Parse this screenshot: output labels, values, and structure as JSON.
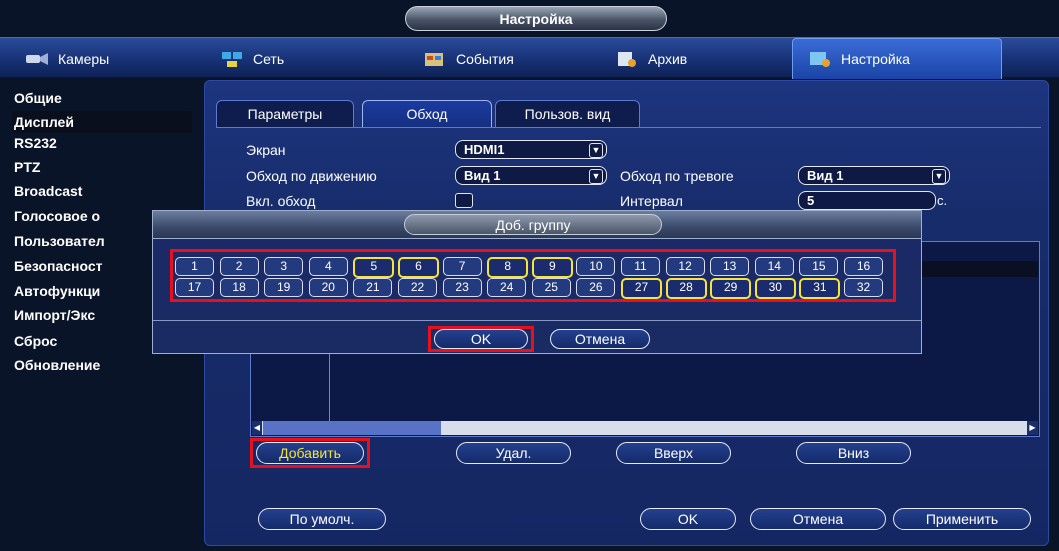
{
  "window": {
    "title": "Настройка"
  },
  "topnav": {
    "items": [
      {
        "label": "Камеры",
        "icon": "camera-icon"
      },
      {
        "label": "Сеть",
        "icon": "network-icon"
      },
      {
        "label": "События",
        "icon": "events-icon"
      },
      {
        "label": "Архив",
        "icon": "archive-icon"
      },
      {
        "label": "Настройка",
        "icon": "settings-icon",
        "active": true
      }
    ]
  },
  "sidebar": {
    "items": [
      {
        "label": "Общие"
      },
      {
        "label": "Дисплей",
        "active": true
      },
      {
        "label": "RS232"
      },
      {
        "label": "PTZ"
      },
      {
        "label": "Broadcast"
      },
      {
        "label": "Голосовое о"
      },
      {
        "label": "Пользовател"
      },
      {
        "label": "Безопасност"
      },
      {
        "label": "Автофункци"
      },
      {
        "label": "Импорт/Экс"
      },
      {
        "label": "Сброс"
      },
      {
        "label": "Обновление"
      }
    ]
  },
  "tabs": [
    {
      "label": "Параметры"
    },
    {
      "label": "Обход",
      "active": true
    },
    {
      "label": "Пользов. вид"
    }
  ],
  "form": {
    "screen_label": "Экран",
    "screen_value": "HDMI1",
    "motion_tour_label": "Обход по движению",
    "motion_tour_value": "Вид 1",
    "alarm_tour_label": "Обход по тревоге",
    "alarm_tour_value": "Вид 1",
    "enable_tour_label": "Вкл. обход",
    "enable_tour_checked": false,
    "interval_label": "Интервал",
    "interval_value": "5",
    "interval_unit": "с."
  },
  "list_buttons": {
    "add": "Добавить",
    "delete": "Удал.",
    "up": "Вверх",
    "down": "Вниз"
  },
  "footer": {
    "default": "По умолч.",
    "ok": "OK",
    "cancel": "Отмена",
    "apply": "Применить"
  },
  "dialog": {
    "title": "Доб. группу",
    "ok": "OK",
    "cancel": "Отмена",
    "channels_row1": [
      "1",
      "2",
      "3",
      "4",
      "5",
      "6",
      "7",
      "8",
      "9",
      "10",
      "11",
      "12",
      "13",
      "14",
      "15",
      "16"
    ],
    "channels_row2": [
      "17",
      "18",
      "19",
      "20",
      "21",
      "22",
      "23",
      "24",
      "25",
      "26",
      "27",
      "28",
      "29",
      "30",
      "31",
      "32"
    ],
    "selected": [
      "5",
      "6",
      "8",
      "9",
      "27",
      "28",
      "29",
      "30",
      "31"
    ]
  },
  "colors": {
    "highlight_red": "#e8101c",
    "selected_yellow": "#f6e43a",
    "panel_blue": "#172c6a"
  }
}
